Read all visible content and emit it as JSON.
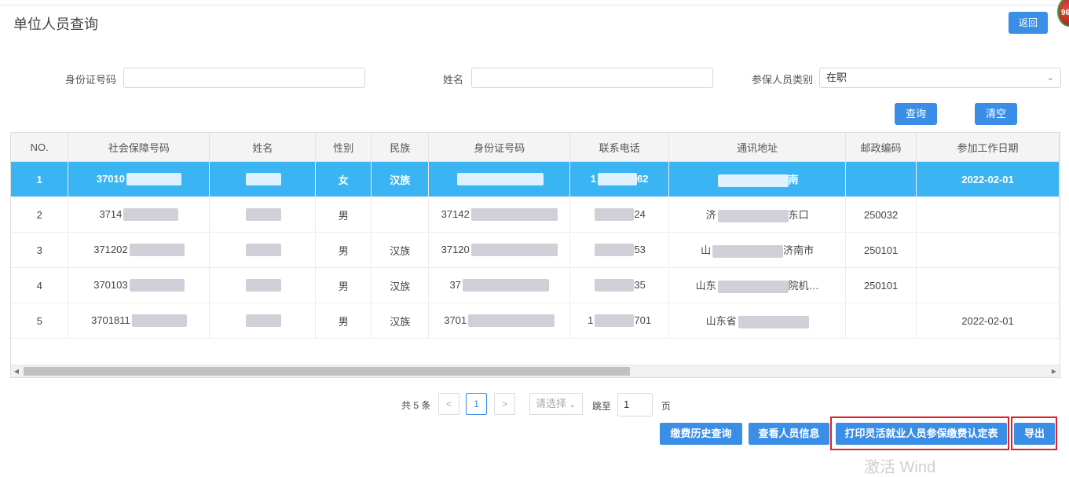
{
  "page": {
    "title": "单位人员查询",
    "back_label": "返回",
    "badge": "96"
  },
  "search": {
    "id_label": "身份证号码",
    "id_value": "",
    "name_label": "姓名",
    "name_value": "",
    "type_label": "参保人员类别",
    "type_value": "在职",
    "query_label": "查询",
    "clear_label": "清空"
  },
  "table": {
    "columns": [
      "NO.",
      "社会保障号码",
      "姓名",
      "性别",
      "民族",
      "身份证号码",
      "联系电话",
      "通讯地址",
      "邮政编码",
      "参加工作日期"
    ],
    "rows": [
      {
        "no": "1",
        "ssn": "37010",
        "name": "",
        "gender": "女",
        "ethnic": "汉族",
        "idno": "",
        "phone_a": "1",
        "phone_b": "62",
        "addr_a": "",
        "addr_b": "南",
        "zip": "",
        "date": "2022-02-01"
      },
      {
        "no": "2",
        "ssn": "3714",
        "name": "",
        "gender": "男",
        "ethnic": "",
        "idno": "37142",
        "phone_a": "",
        "phone_b": "24",
        "addr_a": "济",
        "addr_b": "东口",
        "zip": "250032",
        "date": ""
      },
      {
        "no": "3",
        "ssn": "371202",
        "name": "",
        "gender": "男",
        "ethnic": "汉族",
        "idno": "37120",
        "phone_a": "",
        "phone_b": "53",
        "addr_a": "山",
        "addr_b": "济南市",
        "zip": "250101",
        "date": ""
      },
      {
        "no": "4",
        "ssn": "370103",
        "name": "",
        "gender": "男",
        "ethnic": "汉族",
        "idno": "37",
        "phone_a": "",
        "phone_b": "35",
        "addr_a": "山东",
        "addr_b": "院机…",
        "zip": "250101",
        "date": ""
      },
      {
        "no": "5",
        "ssn": "3701811",
        "name": "",
        "gender": "男",
        "ethnic": "汉族",
        "idno": "3701",
        "phone_a": "1",
        "phone_b": "701",
        "addr_a": "山东省",
        "addr_b": "",
        "zip": "",
        "date": "2022-02-01"
      }
    ]
  },
  "pager": {
    "total": "共 5 条",
    "current_page": "1",
    "size_placeholder": "请选择",
    "jump_label": "跳至",
    "jump_value": "1",
    "page_unit": "页"
  },
  "actions": {
    "history": "缴费历史查询",
    "view": "查看人员信息",
    "print": "打印灵活就业人员参保缴费认定表",
    "export": "导出"
  },
  "watermark": "激活 Wind",
  "colors": {
    "accent": "#3a8ee6",
    "selected_row": "#3ab4f2",
    "highlight_box": "#e0202a"
  }
}
